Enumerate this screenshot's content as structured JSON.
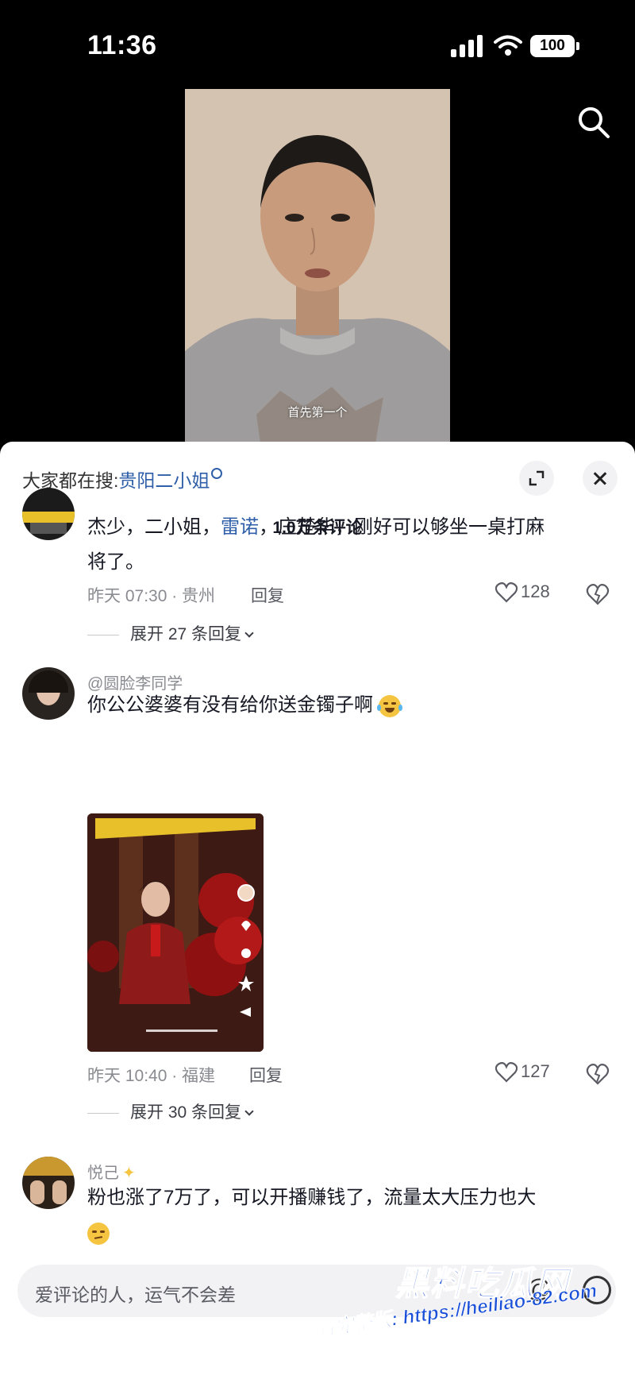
{
  "status": {
    "time": "11:36",
    "battery": "100"
  },
  "video": {
    "subtitle": "首先第一个"
  },
  "panel": {
    "hot_search_prefix": "大家都在搜:",
    "hot_search_keyword": "贵阳二小姐",
    "comment_count": "1.0万条评论"
  },
  "comments": [
    {
      "username": "",
      "text_parts": [
        "杰少，二小姐，",
        "雷诺",
        "，庄楚华，刚好可以够坐一桌打麻",
        "将了。"
      ],
      "time_location": "昨天 07:30 · 贵州",
      "reply_label": "回复",
      "likes": "128",
      "expand_label": "展开 27 条回复"
    },
    {
      "username": "@圆脸李同学",
      "text": "你公公婆婆有没有给你送金镯子啊",
      "time_location": "昨天 10:40 · 福建",
      "reply_label": "回复",
      "likes": "127",
      "expand_label": "展开 30 条回复"
    },
    {
      "username": "悦己",
      "text": "粉也涨了7万了，可以开播赚钱了，流量太大压力也大"
    }
  ],
  "input": {
    "placeholder": "爱评论的人，运气不会差"
  },
  "watermark": {
    "title": "黑料吃瓜网",
    "url": "看完整版: https://heiliao-82.com"
  },
  "colors": {
    "mention": "#2f5fa8",
    "panel_bg": "#ffffff",
    "watermark": "#1a4fd8"
  }
}
